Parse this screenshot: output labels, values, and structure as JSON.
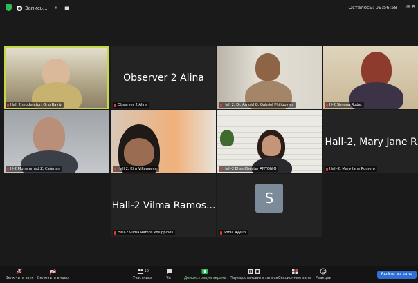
{
  "topbar": {
    "recording_label": "Запись...",
    "pause_symbol": "⏸",
    "stop_symbol": "■",
    "remaining": "Осталось: 09:56:58",
    "view_label": "⊞ В"
  },
  "tiles": [
    {
      "type": "video",
      "label": "Hall 2 moderator: Orio Raviv",
      "active": true
    },
    {
      "type": "name",
      "display_name": "Observer 2 Alina",
      "label": "Observer 2 Alina"
    },
    {
      "type": "video",
      "label": "Hall 2, Dr. Arnold G. Gabriel Philippines"
    },
    {
      "type": "video",
      "label": "H-2 Simona Rodat"
    },
    {
      "type": "video",
      "label": "H-2 Muhammed Z. Çağman"
    },
    {
      "type": "video",
      "label": "Hall 2, Kim Villanueva"
    },
    {
      "type": "video",
      "label": "Hall-2 Elise Chester ANTONIO"
    },
    {
      "type": "name",
      "display_name": "Hall-2, Mary Jane R...",
      "label": "Hall-2, Mary Jane Romero"
    },
    {
      "type": "name",
      "display_name": "Hall-2 Vilma Ramos...",
      "label": "Hall-2 Vilma Ramos Philippines"
    },
    {
      "type": "avatar",
      "initial": "S",
      "label": "Sonia Ayyub"
    }
  ],
  "toolbar": {
    "unmute": "Включить звук",
    "start_video": "Включить видео",
    "participants": "Участники",
    "participants_count": "10",
    "chat": "Чат",
    "share_screen": "Демонстрация экрана",
    "pause_stop_recording": "Пауза/остановить запись",
    "breakout_rooms": "Сессионные залы",
    "reactions": "Реакции",
    "leave": "Выйти из зала"
  },
  "colors": {
    "active_border": "#c5d84a",
    "share_green": "#2dbb55",
    "leave_blue": "#2f6fd6",
    "muted_red": "#e23a3a",
    "avatar_bg": "#7c8b9a"
  }
}
